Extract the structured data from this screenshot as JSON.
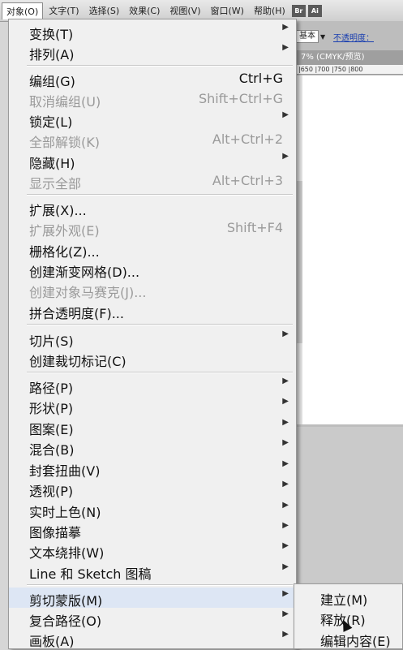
{
  "menubar": {
    "app_icon": "Ai",
    "items": [
      "对象(O)",
      "文字(T)",
      "选择(S)",
      "效果(C)",
      "视图(V)",
      "窗口(W)",
      "帮助(H)"
    ],
    "extra": "Br"
  },
  "options_bar": {
    "preset": "基本",
    "opacity_link": "不透明度："
  },
  "document_tab": "7% (CMYK/预览)",
  "ruler_text": "|650  |700  |750  |800",
  "object_menu": {
    "items": [
      {
        "label": "变换(T)",
        "submenu": true
      },
      {
        "label": "排列(A)",
        "submenu": true
      },
      {
        "label": "编组(G)",
        "shortcut": "Ctrl+G"
      },
      {
        "label": "取消编组(U)",
        "shortcut": "Shift+Ctrl+G",
        "disabled": true
      },
      {
        "label": "锁定(L)",
        "submenu": true
      },
      {
        "label": "全部解锁(K)",
        "shortcut": "Alt+Ctrl+2",
        "disabled": true
      },
      {
        "label": "隐藏(H)",
        "submenu": true
      },
      {
        "label": "显示全部",
        "shortcut": "Alt+Ctrl+3",
        "disabled": true
      },
      {
        "label": "扩展(X)..."
      },
      {
        "label": "扩展外观(E)",
        "shortcut": "Shift+F4",
        "disabled": true
      },
      {
        "label": "栅格化(Z)..."
      },
      {
        "label": "创建渐变网格(D)..."
      },
      {
        "label": "创建对象马赛克(J)...",
        "disabled": true
      },
      {
        "label": "拼合透明度(F)..."
      },
      {
        "label": "切片(S)",
        "submenu": true
      },
      {
        "label": "创建裁切标记(C)"
      },
      {
        "label": "路径(P)",
        "submenu": true
      },
      {
        "label": "形状(P)",
        "submenu": true
      },
      {
        "label": "图案(E)",
        "submenu": true
      },
      {
        "label": "混合(B)",
        "submenu": true
      },
      {
        "label": "封套扭曲(V)",
        "submenu": true
      },
      {
        "label": "透视(P)",
        "submenu": true
      },
      {
        "label": "实时上色(N)",
        "submenu": true
      },
      {
        "label": "图像描摹",
        "submenu": true
      },
      {
        "label": "文本绕排(W)",
        "submenu": true
      },
      {
        "label": "Line 和 Sketch 图稿",
        "submenu": true
      },
      {
        "label": "剪切蒙版(M)",
        "submenu": true,
        "highlighted": true
      },
      {
        "label": "复合路径(O)",
        "submenu": true
      },
      {
        "label": "画板(A)",
        "submenu": true
      }
    ]
  },
  "clipping_submenu": {
    "items": [
      "建立(M)",
      "释放(R)",
      "编辑内容(E)"
    ]
  },
  "colors": {
    "menu_bg": "#f0f0f0",
    "highlight": "#dde6f4",
    "disabled_text": "#9a9a9a"
  }
}
